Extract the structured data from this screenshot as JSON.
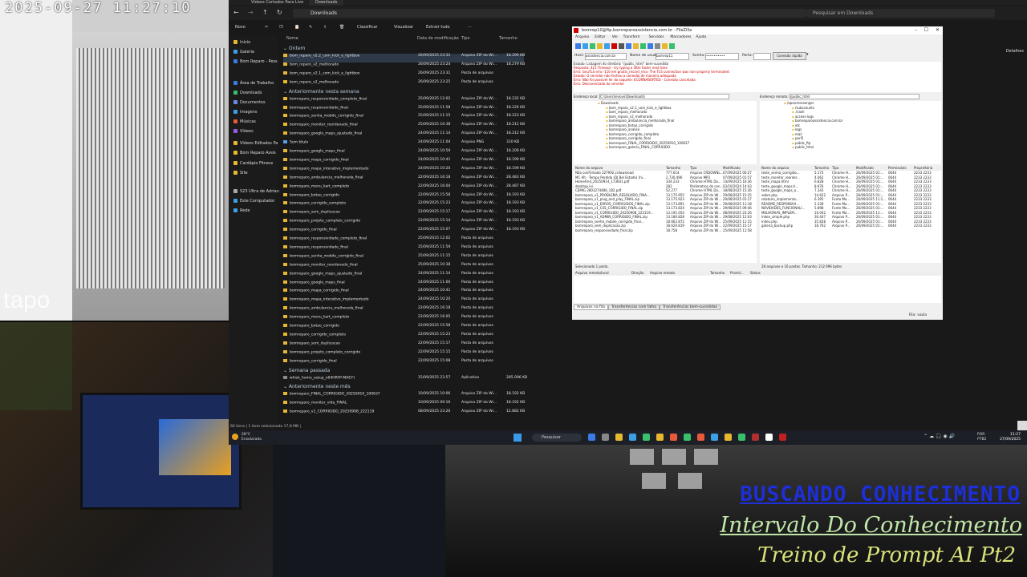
{
  "camera_feed": {
    "timestamp": "2025-09-27  11:27:10",
    "brand": "tapo"
  },
  "overlay": {
    "line1": "BUSCANDO CONHECIMENTO",
    "line2": "Intervalo Do Conhecimento",
    "line3": "Treino de Prompt AI Pt2"
  },
  "explorer": {
    "tabs": [
      "Vídeos Cortados Para Live",
      "Downloads"
    ],
    "address": "Downloads",
    "search_placeholder": "Pesquisar em Downloads",
    "toolbar": [
      "Novo",
      "Classificar",
      "Visualizar",
      "Extrair tudo",
      "···"
    ],
    "details_label": "Detalhes",
    "columns": [
      "Nome",
      "Data de modificação",
      "Tipo",
      "Tamanho"
    ],
    "nav": [
      {
        "label": "Início",
        "color": "#e8b730"
      },
      {
        "label": "Galeria",
        "color": "#3aa0e8"
      },
      {
        "label": "Bom Reparo - Pess",
        "color": "#3a7be8"
      },
      {
        "label": "Área de Trabalho",
        "color": "#3a7be8"
      },
      {
        "label": "Downloads",
        "color": "#3ac06a"
      },
      {
        "label": "Documentos",
        "color": "#6a8ae8"
      },
      {
        "label": "Imagens",
        "color": "#3aa0e8"
      },
      {
        "label": "Músicas",
        "color": "#e85a3a"
      },
      {
        "label": "Vídeos",
        "color": "#9a5ae8"
      },
      {
        "label": "Vídeos Editados Pa",
        "color": "#e8b730"
      },
      {
        "label": "Bom Reparo Assis",
        "color": "#e8b730"
      },
      {
        "label": "Cardápio Fitness",
        "color": "#e8b730"
      },
      {
        "label": "Site",
        "color": "#e8b730"
      },
      {
        "label": "S23 Ultra de Adrian",
        "color": "#aaaaaa"
      },
      {
        "label": "Este Computador",
        "color": "#3aa0e8"
      },
      {
        "label": "Rede",
        "color": "#3aa0e8"
      }
    ],
    "groups": [
      {
        "name": "Ontem",
        "rows": [
          {
            "name": "bom_reparo_v2.2_com_kick_e_lightbox",
            "date": "26/09/2025 23:31",
            "type": "Arquivo ZIP do Wi...",
            "size": "18.290 KB",
            "zip": true,
            "selected": true
          },
          {
            "name": "bom_reparo_v2_melhorado",
            "date": "26/09/2025 23:24",
            "type": "Arquivo ZIP do Wi...",
            "size": "18.279 KB",
            "zip": true
          },
          {
            "name": "bom_reparo_v2.1_com_kick_e_lightbox",
            "date": "26/09/2025 23:31",
            "type": "Pasta de arquivos",
            "size": "",
            "zip": false
          },
          {
            "name": "bom_reparo_v2_melhorado",
            "date": "26/09/2025 23:25",
            "type": "Pasta de arquivos",
            "size": "",
            "zip": false
          }
        ]
      },
      {
        "name": "Anteriormente nesta semana",
        "rows": [
          {
            "name": "bomreparo_responsividade_completo_final",
            "date": "25/09/2025 12:02",
            "type": "Arquivo ZIP do Wi...",
            "size": "18.232 KB",
            "zip": true
          },
          {
            "name": "bomreparo_responsividade_final",
            "date": "25/09/2025 11:58",
            "type": "Arquivo ZIP do Wi...",
            "size": "18.226 KB",
            "zip": true
          },
          {
            "name": "bomreparo_senha_mobile_corrigido_final",
            "date": "25/09/2025 11:15",
            "type": "Arquivo ZIP do Wi...",
            "size": "18.223 KB",
            "zip": true
          },
          {
            "name": "bomreparo_monitor_reordenado_final",
            "date": "25/09/2025 10:38",
            "type": "Arquivo ZIP do Wi...",
            "size": "18.212 KB",
            "zip": true
          },
          {
            "name": "bomreparo_google_maps_ajustado_final",
            "date": "24/09/2025 11:14",
            "type": "Arquivo ZIP do Wi...",
            "size": "18.212 KB",
            "zip": true
          },
          {
            "name": "Sem título",
            "date": "24/09/2025 11:04",
            "type": "Arquivo PNG",
            "size": "310 KB",
            "zip": false,
            "png": true
          },
          {
            "name": "bomreparo_google_maps_final",
            "date": "24/09/2025 10:59",
            "type": "Arquivo ZIP do Wi...",
            "size": "18.206 KB",
            "zip": true
          },
          {
            "name": "bomreparo_mapa_corrigido_final",
            "date": "24/09/2025 10:41",
            "type": "Arquivo ZIP do Wi...",
            "size": "18.199 KB",
            "zip": true
          },
          {
            "name": "bomreparo_mapa_interativo_implementado",
            "date": "24/09/2025 10:20",
            "type": "Arquivo ZIP do Wi...",
            "size": "18.199 KB",
            "zip": true
          },
          {
            "name": "bomreparo_ambulancia_melhorada_final",
            "date": "22/09/2025 16:18",
            "type": "Arquivo ZIP do Wi...",
            "size": "28.483 KB",
            "zip": true
          },
          {
            "name": "bomreparo_menu_kart_completo",
            "date": "22/09/2025 16:04",
            "type": "Arquivo ZIP do Wi...",
            "size": "28.487 KB",
            "zip": true
          },
          {
            "name": "bomreparo_botao_corrigido",
            "date": "22/09/2025 15:58",
            "type": "Arquivo ZIP do Wi...",
            "size": "18.193 KB",
            "zip": true
          },
          {
            "name": "bomreparo_corrigido_completo",
            "date": "22/09/2025 15:23",
            "type": "Arquivo ZIP do Wi...",
            "size": "18.193 KB",
            "zip": true
          },
          {
            "name": "bomreparo_sem_duplicacao",
            "date": "22/09/2025 15:17",
            "type": "Arquivo ZIP do Wi...",
            "size": "18.193 KB",
            "zip": true
          },
          {
            "name": "bomreparo_projeto_completo_corrigido",
            "date": "22/09/2025 15:14",
            "type": "Arquivo ZIP do Wi...",
            "size": "18.193 KB",
            "zip": true
          },
          {
            "name": "bomreparo_corrigido_final",
            "date": "22/09/2025 15:07",
            "type": "Arquivo ZIP do Wi...",
            "size": "18.193 KB",
            "zip": true
          },
          {
            "name": "bomreparo_responsividade_completo_final",
            "date": "25/09/2025 12:02",
            "type": "Pasta de arquivos",
            "size": "",
            "zip": false
          },
          {
            "name": "bomreparo_responsividade_final",
            "date": "25/09/2025 11:59",
            "type": "Pasta de arquivos",
            "size": "",
            "zip": false
          },
          {
            "name": "bomreparo_senha_mobile_corrigido_final",
            "date": "25/09/2025 11:15",
            "type": "Pasta de arquivos",
            "size": "",
            "zip": false
          },
          {
            "name": "bomreparo_monitor_reordenado_final",
            "date": "25/09/2025 10:38",
            "type": "Pasta de arquivos",
            "size": "",
            "zip": false
          },
          {
            "name": "bomreparo_google_maps_ajustado_final",
            "date": "24/09/2025 11:14",
            "type": "Pasta de arquivos",
            "size": "",
            "zip": false
          },
          {
            "name": "bomreparo_google_maps_final",
            "date": "24/09/2025 11:00",
            "type": "Pasta de arquivos",
            "size": "",
            "zip": false
          },
          {
            "name": "bomreparo_mapa_corrigido_final",
            "date": "24/09/2025 10:41",
            "type": "Pasta de arquivos",
            "size": "",
            "zip": false
          },
          {
            "name": "bomreparo_mapa_interativo_implementado",
            "date": "24/09/2025 10:20",
            "type": "Pasta de arquivos",
            "size": "",
            "zip": false
          },
          {
            "name": "bomreparo_ambulancia_melhorada_final",
            "date": "22/09/2025 16:18",
            "type": "Pasta de arquivos",
            "size": "",
            "zip": false
          },
          {
            "name": "bomreparo_menu_kart_completo",
            "date": "22/09/2025 16:05",
            "type": "Pasta de arquivos",
            "size": "",
            "zip": false
          },
          {
            "name": "bomreparo_botao_corrigido",
            "date": "22/09/2025 15:58",
            "type": "Pasta de arquivos",
            "size": "",
            "zip": false
          },
          {
            "name": "bomreparo_corrigido_completo",
            "date": "22/09/2025 15:23",
            "type": "Pasta de arquivos",
            "size": "",
            "zip": false
          },
          {
            "name": "bomreparo_sem_duplicacao",
            "date": "22/09/2025 15:17",
            "type": "Pasta de arquivos",
            "size": "",
            "zip": false
          },
          {
            "name": "bomreparo_projeto_completo_corrigido",
            "date": "22/09/2025 15:15",
            "type": "Pasta de arquivos",
            "size": "",
            "zip": false
          },
          {
            "name": "bomreparo_corrigido_final",
            "date": "22/09/2025 15:08",
            "type": "Pasta de arquivos",
            "size": "",
            "zip": false
          }
        ]
      },
      {
        "name": "Semana passada",
        "rows": [
          {
            "name": "whisk_home_setup_x64HRYP-MAEY]",
            "date": "15/09/2025 23:57",
            "type": "Aplicativo",
            "size": "285.096 KB",
            "zip": false,
            "app": true
          }
        ]
      },
      {
        "name": "Anteriormente neste mês",
        "rows": [
          {
            "name": "bomreparo_FINAL_CORRIGIDO_20250910_100637",
            "date": "10/09/2025 10:06",
            "type": "Arquivo ZIP do Wi...",
            "size": "18.192 KB",
            "zip": true
          },
          {
            "name": "bomreparo_monitor_vida_FINAL",
            "date": "10/09/2025 09:16",
            "type": "Arquivo ZIP do Wi...",
            "size": "18.192 KB",
            "zip": true
          },
          {
            "name": "bomreparo_v1_CORRIGIDO_20250908_222119",
            "date": "08/09/2025 23:26",
            "type": "Arquivo ZIP do Wi...",
            "size": "12.882 KB",
            "zip": true
          }
        ]
      }
    ],
    "status": "66 itens  |  1 item selecionado 17,8 MB  |"
  },
  "filezilla": {
    "title": "bomrep10@ftp.bomreparoassistencia.com.br - FileZilla",
    "menu": [
      "Arquivo",
      "Editar",
      "Ver",
      "Transferir",
      "Servidor",
      "Marcadores",
      "Ajuda"
    ],
    "quickconnect": {
      "host_label": "Host:",
      "host": "assistencia.com.br",
      "user_label": "Nome de usuário:",
      "user": "bomrep11",
      "pass_label": "Senha:",
      "pass": "••••••••••",
      "port_label": "Porta:",
      "button": "Conexão rápida"
    },
    "log": [
      {
        "k": "Estado:",
        "v": "Listagem do diretório \"/public_html\" bem-sucedida",
        "c": "normal"
      },
      {
        "k": "Resposta:",
        "v": "421 Timeout - try typing a little faster next time",
        "c": "red"
      },
      {
        "k": "Erro:",
        "v": "GnuTLS erro -110 em gnutls_record_recv: The TLS connection was non-properly terminated.",
        "c": "red"
      },
      {
        "k": "Estado:",
        "v": "O servidor não fechou a conexão de maneira adequada",
        "c": "red"
      },
      {
        "k": "Erro:",
        "v": "Não foi possível ler do soquete: ECONNABORTED - Conexão cancelada",
        "c": "red"
      },
      {
        "k": "Erro:",
        "v": "Desconectado do servidor",
        "c": "red"
      }
    ],
    "local_label": "Endereço local:",
    "local_path": "C:\\Users\\lenovo\\Downloads\\",
    "remote_label": "Endereço remoto:",
    "remote_path": "/public_html",
    "local_tree": [
      "Downloads",
      "bom_reparo_v2.1_com_kick_e_lightbox",
      "bom_reparo_melhorado",
      "bom_reparo_v2_melhorado",
      "bomreparo_ambulancia_melhorada_final",
      "bomreparo_botao_corrigido",
      "bomreparo_analise",
      "bomreparo_corrigido_completo",
      "bomreparo_corrigido_final",
      "bomreparo_FINAL_CORRIGIDO_20250910_100637",
      "bomreparo_galeria_FINAL_CORRIGIDO"
    ],
    "remote_tree": [
      "/openmessenger",
      "/subscounts",
      ".trash",
      "access-logs",
      "bomreparoassistencia.com.br",
      "etc",
      "logs",
      "mail",
      "perl5",
      "public_ftp",
      "public_html"
    ],
    "local_cols": [
      "Nome do arquivo",
      "Tamanho",
      "Tipo",
      "Modificado"
    ],
    "local_files": [
      {
        "n": "Não confirmado 327992.crdownload",
        "s": "777.614",
        "t": "Arquivo CRDOWNL...",
        "m": "07/09/2025 00:27"
      },
      {
        "n": "MC Alt - Tempo Perdido (DJ Bel Estado) (hi...",
        "s": "2.730.496",
        "t": "Arquivo MP3",
        "m": "07/09/2025 01:57"
      },
      {
        "n": "HomeFind_20250914_173641.pdf",
        "s": "334.233",
        "t": "Chrome HTML Do...",
        "m": "14/09/2025 16:36"
      },
      {
        "n": "desktop.ini",
        "s": "282",
        "t": "Parâmetros de con...",
        "m": "03/10/2024 14:43"
      },
      {
        "n": "CEMIG 2803274486_182.pdf",
        "s": "52.277",
        "t": "Chrome HTML Do...",
        "m": "18/08/2025 15:36"
      },
      {
        "n": "bomreparo_v1_PROBLEMA_RESOLVIDO_FINA...",
        "s": "13.175.955",
        "t": "Arquivo ZIP do Wi...",
        "m": "29/08/2025 15:25"
      },
      {
        "n": "bomreparo_v1_plug_and_play_FINAL.zip",
        "s": "13.175.923",
        "t": "Arquivo ZIP do Wi...",
        "m": "29/08/2025 01:17"
      },
      {
        "n": "bomreparo_v1_ERROS_CORRIGIDOS_FINAL.zip",
        "s": "13.173.891",
        "t": "Arquivo ZIP do Wi...",
        "m": "29/08/2025 11:18"
      },
      {
        "n": "bomreparo_v1_CSS_CORRIGIDO_FINAL.zip",
        "s": "13.173.824",
        "t": "Arquivo ZIP do Wi...",
        "m": "29/08/2025 09:46"
      },
      {
        "n": "bomreparo_v1_CORRIGIDO_20250908_222119...",
        "s": "13.191.054",
        "t": "Arquivo ZIP do Wi...",
        "m": "08/09/2025 23:26"
      },
      {
        "n": "bomreparo_v1_ADMIN_CORRIGIDO_FINAL.zip",
        "s": "13.180.828",
        "t": "Arquivo ZIP do Wi...",
        "m": "29/08/2025 12:03"
      },
      {
        "n": "bomreparo_senha_mobile_corrigido_final...",
        "s": "18.662.872",
        "t": "Arquivo ZIP do Wi...",
        "m": "25/09/2025 11:15"
      },
      {
        "n": "bomreparo_sem_duplicacao.zip",
        "s": "18.620.819",
        "t": "Arquivo ZIP do Wi...",
        "m": "22/09/2025 15:17"
      },
      {
        "n": "bomreparo_responsividade_final.zip",
        "s": "18.758",
        "t": "Arquivo ZIP do Wi...",
        "m": "25/09/2025 11:58"
      }
    ],
    "local_status": "Selecionado 1 pasta.",
    "remote_cols": [
      "Nome do arquivo",
      "Tamanho",
      "Tipo",
      "Modificado",
      "Permissões",
      "Proprietário"
    ],
    "remote_files": [
      {
        "n": "teste_senha_corrigido...",
        "s": "5.173",
        "t": "Chrome H...",
        "m": "26/09/2025 01:..."
      },
      {
        "n": "teste_monitor_reorder...",
        "s": "4.062",
        "t": "Chrome H...",
        "m": "26/09/2025 01:..."
      },
      {
        "n": "teste_mapa.html",
        "s": "6.828",
        "t": "Chrome H...",
        "m": "26/09/2025 01:..."
      },
      {
        "n": "teste_google_maps.h...",
        "s": "8.976",
        "t": "Chrome H...",
        "m": "26/09/2025 01:..."
      },
      {
        "n": "teste_google_maps_a...",
        "s": "7.343",
        "t": "Chrome H...",
        "m": "26/09/2025 01:..."
      },
      {
        "n": "sobre.php",
        "s": "14.622",
        "t": "Arquivo P...",
        "m": "26/09/2025 01:..."
      },
      {
        "n": "relatorio_implementa...",
        "s": "6.395",
        "t": "Fonte Ma...",
        "m": "26/09/2025 11:1..."
      },
      {
        "n": "README_RESPONSIVI...",
        "s": "2.228",
        "t": "Fonte Ma...",
        "m": "26/09/2025 01:..."
      },
      {
        "n": "NOVIDADES_FUNCIONALI...",
        "s": "5.898",
        "t": "Fonte Ma...",
        "m": "26/09/2025 01:..."
      },
      {
        "n": "MELHORIAS_IMPLEM...",
        "s": "10.042",
        "t": "Fonte Ma...",
        "m": "26/09/2025 11:..."
      },
      {
        "n": "index_simple.php",
        "s": "30.447",
        "t": "Arquivo P...",
        "m": "26/09/2025 01:..."
      },
      {
        "n": "index.php",
        "s": "35.838",
        "t": "Arquivo P...",
        "m": "26/09/2025 01:..."
      },
      {
        "n": "galeria_backup.php",
        "s": "18.762",
        "t": "Arquivo P...",
        "m": "26/09/2025 01:..."
      }
    ],
    "remote_perm": "0644",
    "remote_owner": "2233 2233",
    "remote_status": "28 arquivos e 16 pastas. Tamanho: 212.996 bytes",
    "queue_cols": [
      "Arquivo remoto/local",
      "Direção",
      "Arquivo remoto",
      "Tamanho",
      "Priorid...",
      "Status"
    ],
    "queue_tabs": [
      "Arquivos na fila",
      "Transferências com falha",
      "Transferências bem-sucedidas"
    ],
    "queue_status": "Fila: vazia"
  },
  "taskbar": {
    "weather_temp": "28°C",
    "weather_desc": "Ensolarado",
    "search_label": "Pesquisar",
    "lang": "POR PTB2",
    "time": "11:27",
    "date": "27/09/2025",
    "apps": [
      "#3a7be8",
      "#888888",
      "#e8b730",
      "#3aa0e8",
      "#3ac06a",
      "#e8b730",
      "#e85a3a",
      "#3ac06a",
      "#e85a3a",
      "#3aa0e8",
      "#e8b730",
      "#3ac06a",
      "#b03030",
      "#ffffff",
      "#c02020"
    ]
  }
}
